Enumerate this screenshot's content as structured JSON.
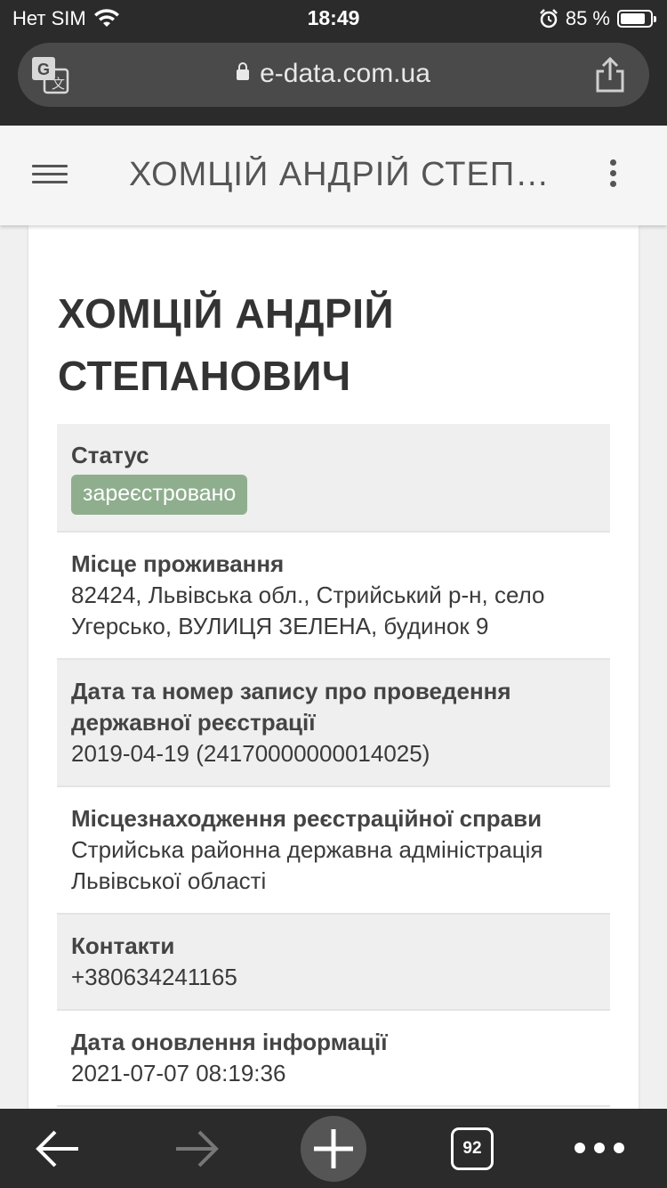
{
  "status_bar": {
    "carrier": "Нет SIM",
    "time": "18:49",
    "battery_text": "85 %",
    "battery_level": 0.85
  },
  "browser": {
    "url": "e-data.com.ua",
    "tabs_count": "92"
  },
  "appbar": {
    "title": "ХОМЦІЙ АНДРІЙ СТЕПАНОВИЧ"
  },
  "person": {
    "name": "ХОМЦІЙ АНДРІЙ СТЕПАНОВИЧ"
  },
  "details": [
    {
      "label": "Статус",
      "value": "зареєстровано",
      "badge": true
    },
    {
      "label": "Місце проживання",
      "value": "82424, Львівська обл., Стрийський р-н, село Угерсько, ВУЛИЦЯ ЗЕЛЕНА, будинок 9"
    },
    {
      "label": "Дата та номер запису про проведення державної реєстрації",
      "value": "2019-04-19 (24170000000014025)"
    },
    {
      "label": "Місцезнаходження реєстраційної справи",
      "value": "Стрийська районна державна адміністрація Львівської області"
    },
    {
      "label": "Контакти",
      "value": "+380634241165"
    },
    {
      "label": "Дата оновлення інформації",
      "value": "2021-07-07 08:19:36"
    }
  ],
  "colors": {
    "badge": "#8fae8e",
    "chrome": "#2b2b2b"
  }
}
